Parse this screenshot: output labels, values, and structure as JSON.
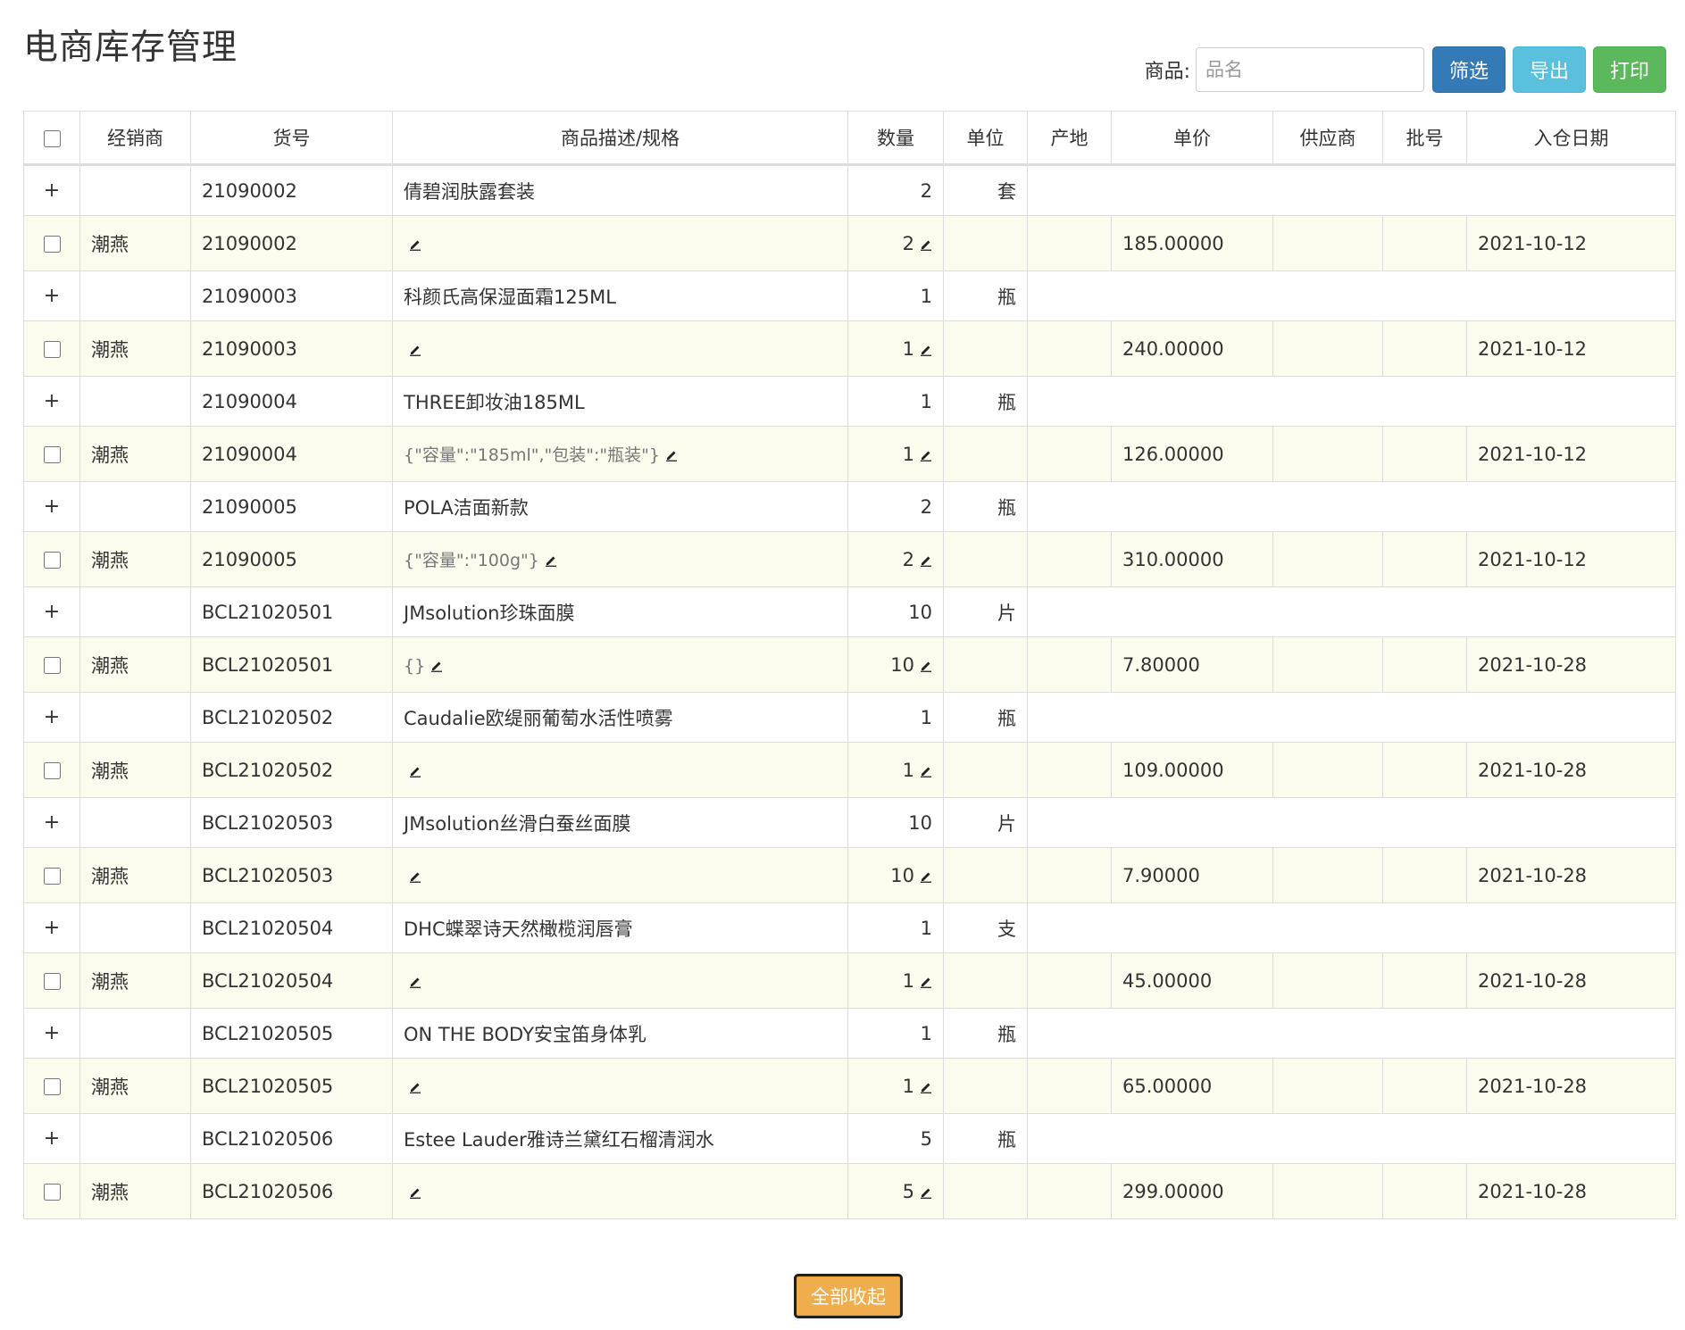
{
  "page": {
    "title": "电商库存管理"
  },
  "filter": {
    "label": "商品:",
    "placeholder": "品名",
    "value": "",
    "buttons": {
      "filter": "筛选",
      "export": "导出",
      "print": "打印"
    }
  },
  "colors": {
    "primary": "#337ab7",
    "info": "#5bc0de",
    "success": "#5cb85c",
    "warning": "#f0ad4e",
    "item_row_bg": "#fcfcee"
  },
  "table": {
    "headers": [
      "经销商",
      "货号",
      "商品描述/规格",
      "数量",
      "单位",
      "产地",
      "单价",
      "供应商",
      "批号",
      "入仓日期"
    ],
    "groups": [
      {
        "toggle": "+",
        "sku": "21090002",
        "name": "倩碧润肤露套装",
        "qty": "2",
        "unit": "套",
        "item": {
          "dealer": "潮燕",
          "sku": "21090002",
          "spec": "",
          "qty": "2",
          "unit": "",
          "origin": "",
          "price": "185.00000",
          "supplier": "",
          "batch": "",
          "date": "2021-10-12"
        }
      },
      {
        "toggle": "+",
        "sku": "21090003",
        "name": "科颜氏高保湿面霜125ML",
        "qty": "1",
        "unit": "瓶",
        "item": {
          "dealer": "潮燕",
          "sku": "21090003",
          "spec": "",
          "qty": "1",
          "unit": "",
          "origin": "",
          "price": "240.00000",
          "supplier": "",
          "batch": "",
          "date": "2021-10-12"
        }
      },
      {
        "toggle": "+",
        "sku": "21090004",
        "name": "THREE卸妆油185ML",
        "qty": "1",
        "unit": "瓶",
        "item": {
          "dealer": "潮燕",
          "sku": "21090004",
          "spec": "{\"容量\":\"185ml\",\"包装\":\"瓶装\"}",
          "qty": "1",
          "unit": "",
          "origin": "",
          "price": "126.00000",
          "supplier": "",
          "batch": "",
          "date": "2021-10-12"
        }
      },
      {
        "toggle": "+",
        "sku": "21090005",
        "name": "POLA洁面新款",
        "qty": "2",
        "unit": "瓶",
        "item": {
          "dealer": "潮燕",
          "sku": "21090005",
          "spec": "{\"容量\":\"100g\"}",
          "qty": "2",
          "unit": "",
          "origin": "",
          "price": "310.00000",
          "supplier": "",
          "batch": "",
          "date": "2021-10-12"
        }
      },
      {
        "toggle": "+",
        "sku": "BCL21020501",
        "name": "JMsolution珍珠面膜",
        "qty": "10",
        "unit": "片",
        "item": {
          "dealer": "潮燕",
          "sku": "BCL21020501",
          "spec": "{}",
          "qty": "10",
          "unit": "",
          "origin": "",
          "price": "7.80000",
          "supplier": "",
          "batch": "",
          "date": "2021-10-28"
        }
      },
      {
        "toggle": "+",
        "sku": "BCL21020502",
        "name": "Caudalie欧缇丽葡萄水活性喷雾",
        "qty": "1",
        "unit": "瓶",
        "item": {
          "dealer": "潮燕",
          "sku": "BCL21020502",
          "spec": "",
          "qty": "1",
          "unit": "",
          "origin": "",
          "price": "109.00000",
          "supplier": "",
          "batch": "",
          "date": "2021-10-28"
        }
      },
      {
        "toggle": "+",
        "sku": "BCL21020503",
        "name": "JMsolution丝滑白蚕丝面膜",
        "qty": "10",
        "unit": "片",
        "item": {
          "dealer": "潮燕",
          "sku": "BCL21020503",
          "spec": "",
          "qty": "10",
          "unit": "",
          "origin": "",
          "price": "7.90000",
          "supplier": "",
          "batch": "",
          "date": "2021-10-28"
        }
      },
      {
        "toggle": "+",
        "sku": "BCL21020504",
        "name": "DHC蝶翠诗天然橄榄润唇膏",
        "qty": "1",
        "unit": "支",
        "item": {
          "dealer": "潮燕",
          "sku": "BCL21020504",
          "spec": "",
          "qty": "1",
          "unit": "",
          "origin": "",
          "price": "45.00000",
          "supplier": "",
          "batch": "",
          "date": "2021-10-28"
        }
      },
      {
        "toggle": "+",
        "sku": "BCL21020505",
        "name": "ON THE BODY安宝笛身体乳",
        "qty": "1",
        "unit": "瓶",
        "item": {
          "dealer": "潮燕",
          "sku": "BCL21020505",
          "spec": "",
          "qty": "1",
          "unit": "",
          "origin": "",
          "price": "65.00000",
          "supplier": "",
          "batch": "",
          "date": "2021-10-28"
        }
      },
      {
        "toggle": "+",
        "sku": "BCL21020506",
        "name": "Estee Lauder雅诗兰黛红石榴清润水",
        "qty": "5",
        "unit": "瓶",
        "item": {
          "dealer": "潮燕",
          "sku": "BCL21020506",
          "spec": "",
          "qty": "5",
          "unit": "",
          "origin": "",
          "price": "299.00000",
          "supplier": "",
          "batch": "",
          "date": "2021-10-28"
        }
      }
    ]
  },
  "footer": {
    "collapse_all": "全部收起"
  }
}
